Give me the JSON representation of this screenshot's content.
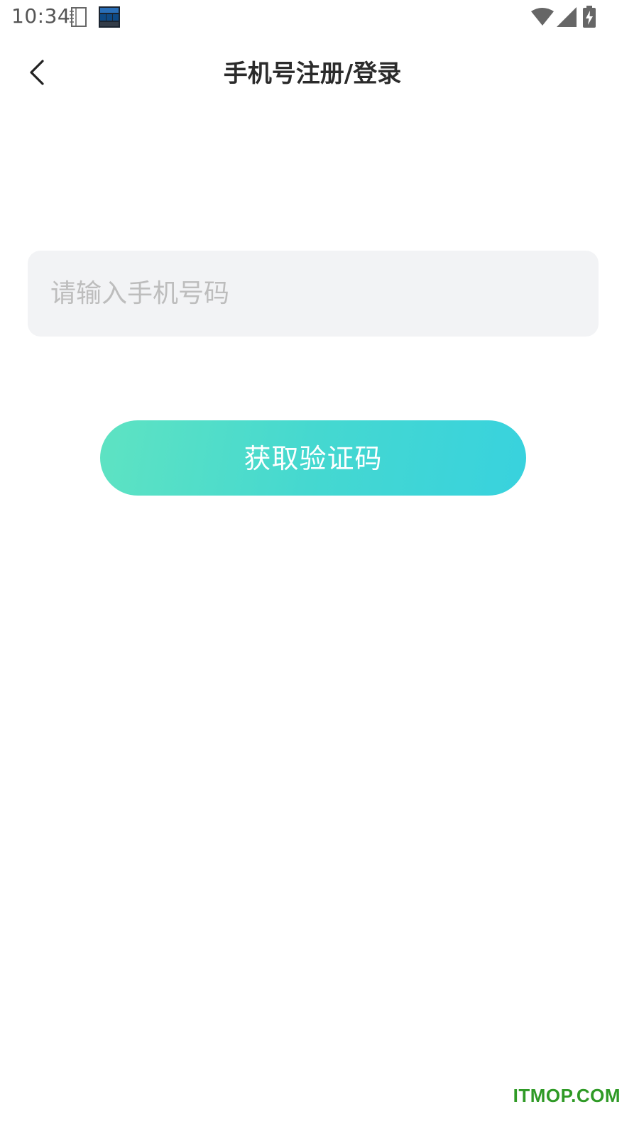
{
  "status_bar": {
    "time": "10:34",
    "icons": [
      "notebook-icon",
      "app-clock-icon",
      "wifi-icon",
      "signal-icon",
      "battery-charging-icon"
    ]
  },
  "header": {
    "title": "手机号注册/登录",
    "back_icon": "chevron-left-icon"
  },
  "phone_input": {
    "placeholder": "请输入手机号码",
    "value": ""
  },
  "get_code_button": {
    "label": "获取验证码",
    "gradient_start": "#5ee3c2",
    "gradient_end": "#38d2de"
  },
  "watermark": {
    "text": "ITMOP.COM",
    "color": "#2f9a26"
  }
}
